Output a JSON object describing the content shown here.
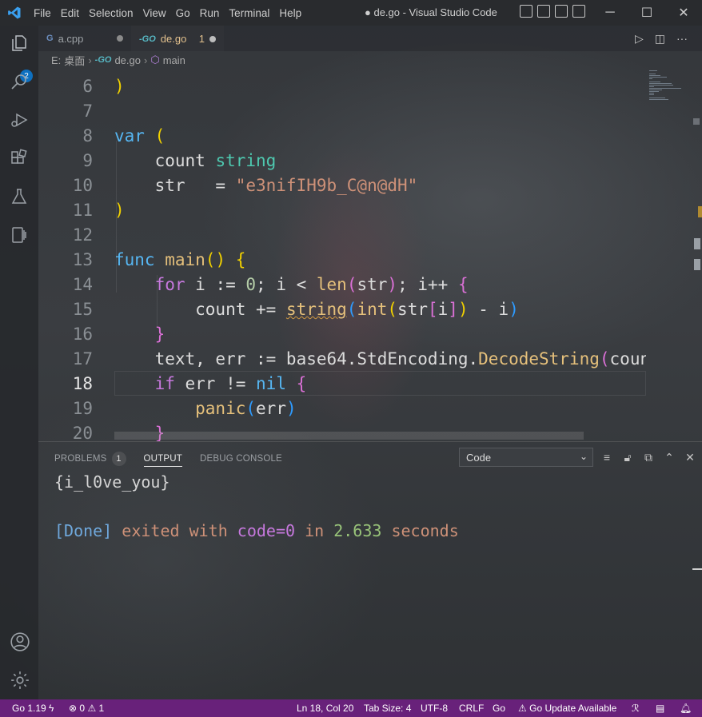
{
  "titlebar": {
    "menu": [
      "File",
      "Edit",
      "Selection",
      "View",
      "Go",
      "Run",
      "Terminal",
      "Help"
    ],
    "title": "● de.go - Visual Studio Code"
  },
  "activity": {
    "explorer_badge": "2"
  },
  "tabs": [
    {
      "name": "a.cpp",
      "glyph": "G",
      "active": false
    },
    {
      "name": "de.go",
      "glyph": "-GO",
      "problems": "1",
      "active": true
    }
  ],
  "breadcrumb": {
    "drive": "E:",
    "folder": "桌面",
    "file": "de.go",
    "symbol": "main"
  },
  "editor": {
    "line_numbers": [
      "6",
      "7",
      "8",
      "9",
      "10",
      "11",
      "12",
      "13",
      "14",
      "15",
      "16",
      "17",
      "18",
      "19",
      "20"
    ],
    "current_line": "18",
    "code": [
      [
        {
          "t": ")",
          "c": "p1"
        }
      ],
      [],
      [
        {
          "t": "var ",
          "c": "kw"
        },
        {
          "t": "(",
          "c": "p1"
        }
      ],
      [
        {
          "t": "    count ",
          "c": "id"
        },
        {
          "t": "string",
          "c": "ty"
        }
      ],
      [
        {
          "t": "    str   = ",
          "c": "id"
        },
        {
          "t": "\"e3nifIH9b_C@n@dH\"",
          "c": "str"
        }
      ],
      [
        {
          "t": ")",
          "c": "p1"
        }
      ],
      [],
      [
        {
          "t": "func ",
          "c": "kw"
        },
        {
          "t": "main",
          "c": "fn"
        },
        {
          "t": "() ",
          "c": "p1"
        },
        {
          "t": "{",
          "c": "p1"
        }
      ],
      [
        {
          "t": "    for ",
          "c": "kw2"
        },
        {
          "t": "i := ",
          "c": "id"
        },
        {
          "t": "0",
          "c": "num"
        },
        {
          "t": "; i < ",
          "c": "id"
        },
        {
          "t": "len",
          "c": "fn"
        },
        {
          "t": "(",
          "c": "p2"
        },
        {
          "t": "str",
          "c": "id"
        },
        {
          "t": ")",
          "c": "p2"
        },
        {
          "t": "; i++ ",
          "c": "id"
        },
        {
          "t": "{",
          "c": "p2"
        }
      ],
      [
        {
          "t": "        count += ",
          "c": "id"
        },
        {
          "t": "string",
          "c": "fn squig"
        },
        {
          "t": "(",
          "c": "p3"
        },
        {
          "t": "int",
          "c": "fn"
        },
        {
          "t": "(",
          "c": "p1"
        },
        {
          "t": "str",
          "c": "id"
        },
        {
          "t": "[",
          "c": "p2"
        },
        {
          "t": "i",
          "c": "id"
        },
        {
          "t": "]",
          "c": "p2"
        },
        {
          "t": ")",
          "c": "p1"
        },
        {
          "t": " - i",
          "c": "id"
        },
        {
          "t": ")",
          "c": "p3"
        }
      ],
      [
        {
          "t": "    }",
          "c": "p2"
        }
      ],
      [
        {
          "t": "    text, err := base64.StdEncoding.",
          "c": "id"
        },
        {
          "t": "DecodeString",
          "c": "fn"
        },
        {
          "t": "(",
          "c": "p2"
        },
        {
          "t": "count",
          "c": "id"
        },
        {
          "t": ")",
          "c": "p2"
        }
      ],
      [
        {
          "t": "    if ",
          "c": "kw2"
        },
        {
          "t": "err != ",
          "c": "id"
        },
        {
          "t": "nil ",
          "c": "kw"
        },
        {
          "t": "{",
          "c": "p2"
        }
      ],
      [
        {
          "t": "        panic",
          "c": "fn"
        },
        {
          "t": "(",
          "c": "p3"
        },
        {
          "t": "err",
          "c": "id"
        },
        {
          "t": ")",
          "c": "p3"
        }
      ],
      [
        {
          "t": "    }",
          "c": "p2"
        }
      ]
    ]
  },
  "panel": {
    "tabs": [
      {
        "label": "PROBLEMS",
        "count": "1"
      },
      {
        "label": "OUTPUT",
        "active": true
      },
      {
        "label": "DEBUG CONSOLE"
      }
    ],
    "channel": "Code",
    "output_line1": "{i_l0ve_you}",
    "output_line2": {
      "done": "[Done]",
      "exited": " exited with ",
      "code": "code=0",
      "in": " in ",
      "secs": "2.633",
      "seconds": " seconds"
    }
  },
  "status": {
    "go_version": "Go 1.19",
    "errors": "0",
    "warnings": "1",
    "position": "Ln 18, Col 20",
    "tab_size": "Tab Size: 4",
    "encoding": "UTF-8",
    "eol": "CRLF",
    "language": "Go",
    "update": "Go Update Available"
  },
  "colors": {
    "status_bar": "#68217a",
    "accent": "#0e70c0"
  }
}
